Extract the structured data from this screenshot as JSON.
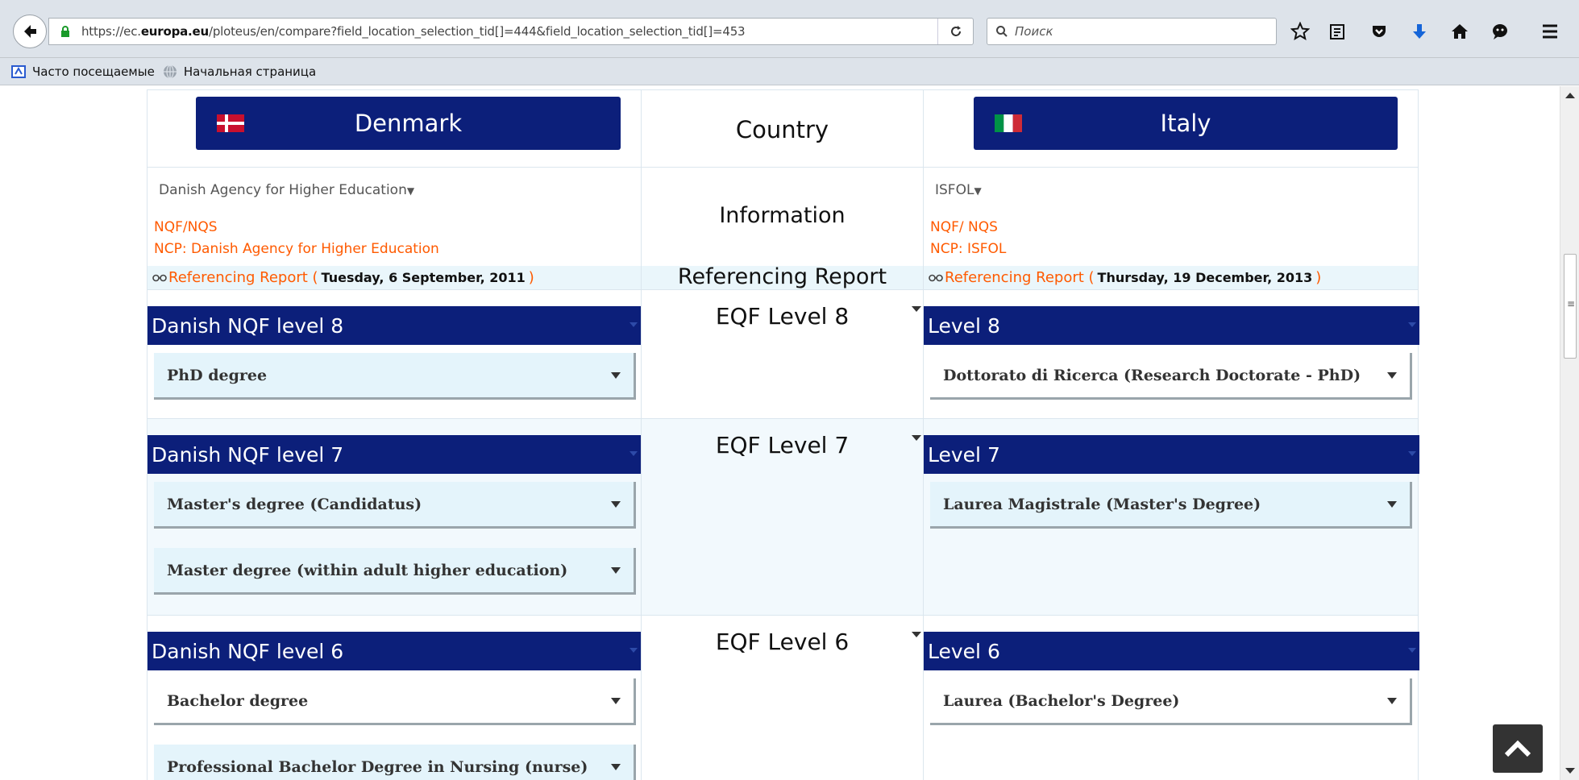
{
  "browser": {
    "url_prefix": "https://ec.",
    "url_domain": "europa.eu",
    "url_rest": "/ploteus/en/compare?field_location_selection_tid[]=444&field_location_selection_tid[]=453",
    "search_placeholder": "Поиск",
    "bookmarks": [
      "Часто посещаемые",
      "Начальная страница"
    ]
  },
  "header": {
    "left_country": "Denmark",
    "mid_label": "Country",
    "right_country": "Italy"
  },
  "info": {
    "mid_label": "Information",
    "left_agency": "Danish Agency for Higher Education",
    "left_nqf": "NQF/NQS",
    "left_ncp": "NCP: Danish Agency for Higher Education",
    "right_agency": "ISFOL",
    "right_nqf": "NQF/ NQS",
    "right_ncp": "NCP: ISFOL"
  },
  "referencing": {
    "mid_label": "Referencing Report",
    "left_link": "Referencing Report (",
    "left_date": "Tuesday, 6 September, 2011",
    "right_link": "Referencing Report (",
    "right_date": "Thursday, 19 December, 2013",
    "close": ")"
  },
  "levels": [
    {
      "eqf": "EQF Level 8",
      "left_level": "Danish NQF level 8",
      "right_level": "Level 8",
      "left_quals": [
        "PhD degree"
      ],
      "right_quals": [
        "Dottorato di Ricerca (Research Doctorate - PhD)"
      ]
    },
    {
      "eqf": "EQF Level 7",
      "left_level": "Danish NQF level 7",
      "right_level": "Level 7",
      "left_quals": [
        "Master's degree (Candidatus)",
        "Master degree (within adult higher education)"
      ],
      "right_quals": [
        "Laurea Magistrale (Master's Degree)"
      ]
    },
    {
      "eqf": "EQF Level 6",
      "left_level": "Danish NQF level 6",
      "right_level": "Level 6",
      "left_quals": [
        "Bachelor degree",
        "Professional Bachelor Degree in Nursing (nurse)"
      ],
      "right_quals": [
        "Laurea (Bachelor's Degree)"
      ]
    }
  ],
  "colors": {
    "navy": "#0c1f7a",
    "orange": "#ff5a00",
    "light_blue": "#e4f4fb"
  }
}
